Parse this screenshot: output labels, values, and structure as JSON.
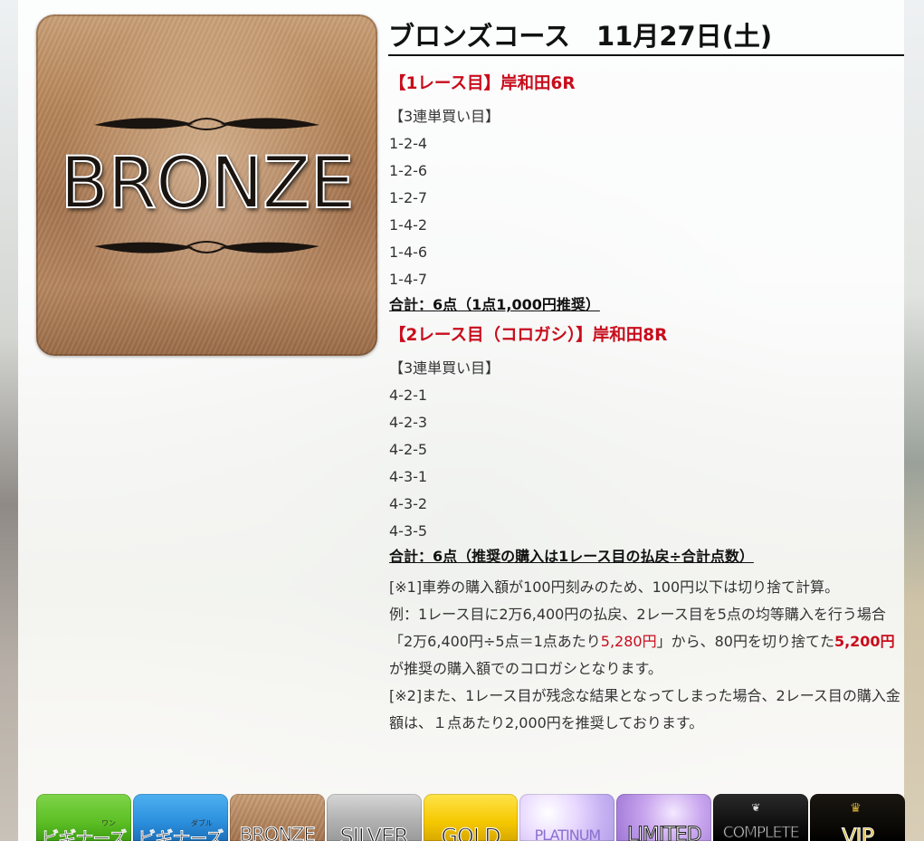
{
  "header": {
    "course_title": "ブロンズコース　11月27日(土)"
  },
  "logo": {
    "word": "BRONZE",
    "colors": {
      "base": "#b08058",
      "text": "#1a1410"
    }
  },
  "races": [
    {
      "title": "【1レース目】岸和田6R",
      "bet_type": "【3連単買い目】",
      "combos": [
        "1-2-4",
        "1-2-6",
        "1-2-7",
        "1-4-2",
        "1-4-6",
        "1-4-7"
      ],
      "total": "合計：6点（1点1,000円推奨）"
    },
    {
      "title": "【2レース目（コロガシ）】岸和田8R",
      "bet_type": "【3連単買い目】",
      "combos": [
        "4-2-1",
        "4-2-3",
        "4-2-5",
        "4-3-1",
        "4-3-2",
        "4-3-5"
      ],
      "total": "合計：6点（推奨の購入は1レース目の払戻÷合計点数）"
    }
  ],
  "notes": {
    "note1": "[※1]車券の購入額が100円刻みのため、100円以下は切り捨て計算。",
    "example_pre": "例：1レース目に2万6,400円の払戻、2レース目を5点の均等購入を行う場合「2万6,400円÷5点＝1点あたり",
    "example_red": "5,280円",
    "example_mid": "」から、80円を切り捨てた",
    "example_red_bold": "5,200円",
    "example_post": "が推奨の購入額でのコロガシとなります。",
    "note2": "[※2]また、1レース目が残念な結果となってしまった場合、2レース目の購入金額は、１点あたり2,000円を推奨しております。"
  },
  "accent_color": "#c80c1c",
  "tabs": [
    {
      "label": "ビギナーズ",
      "ruby": "ワン",
      "icon": "green"
    },
    {
      "label": "ビギナーズ",
      "ruby": "ダブル",
      "icon": "blue"
    },
    {
      "label": "BRONZE",
      "icon": "bronze"
    },
    {
      "label": "SILVER",
      "icon": "silver"
    },
    {
      "label": "GOLD",
      "icon": "gold"
    },
    {
      "label": "PLATINUM",
      "icon": "platinum"
    },
    {
      "label": "LIMITED",
      "icon": "limited"
    },
    {
      "label": "COMPLETE",
      "icon": "complete"
    },
    {
      "label": "VIP",
      "icon": "vip-crown"
    }
  ]
}
